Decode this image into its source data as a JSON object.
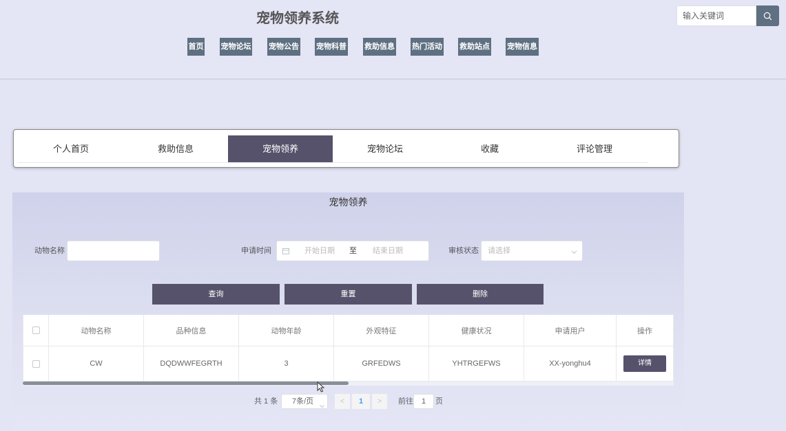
{
  "site": {
    "title": "宠物领养系统"
  },
  "nav": [
    {
      "label": "首页"
    },
    {
      "label": "宠物论坛"
    },
    {
      "label": "宠物公告"
    },
    {
      "label": "宠物科普"
    },
    {
      "label": "救助信息"
    },
    {
      "label": "热门活动"
    },
    {
      "label": "救助站点"
    },
    {
      "label": "宠物信息"
    }
  ],
  "search": {
    "placeholder": "输入关键词",
    "icon": "search-icon"
  },
  "tabs": [
    {
      "label": "个人首页"
    },
    {
      "label": "救助信息"
    },
    {
      "label": "宠物领养",
      "active": true
    },
    {
      "label": "宠物论坛"
    },
    {
      "label": "收藏"
    },
    {
      "label": "评论管理"
    }
  ],
  "section": {
    "title": "宠物领养"
  },
  "filters": {
    "animal_name_label": "动物名称",
    "apply_time_label": "申请时间",
    "start_placeholder": "开始日期",
    "range_sep": "至",
    "end_placeholder": "结束日期",
    "status_label": "审核状态",
    "status_placeholder": "请选择"
  },
  "buttons": {
    "query": "查询",
    "reset": "重置",
    "delete": "删除"
  },
  "table": {
    "headers": [
      "动物名称",
      "品种信息",
      "动物年龄",
      "外观特征",
      "健康状况",
      "申请用户",
      "操作"
    ],
    "rows": [
      {
        "name": "CW",
        "breed": "DQDWWFEGRTH",
        "age": "3",
        "appearance": "GRFEDWS",
        "health": "YHTRGEFWS",
        "user": "XX-yonghu4",
        "action": "详情"
      }
    ]
  },
  "pagination": {
    "total": "共 1 条",
    "page_size": "7条/页",
    "prev": "<",
    "current": "1",
    "next": ">",
    "goto_label": "前往",
    "goto_value": "1",
    "page_unit": "页"
  },
  "colors": {
    "nav_bg": "#5e7081",
    "accent": "#56526b",
    "page_bg": "#e3e4f4"
  }
}
